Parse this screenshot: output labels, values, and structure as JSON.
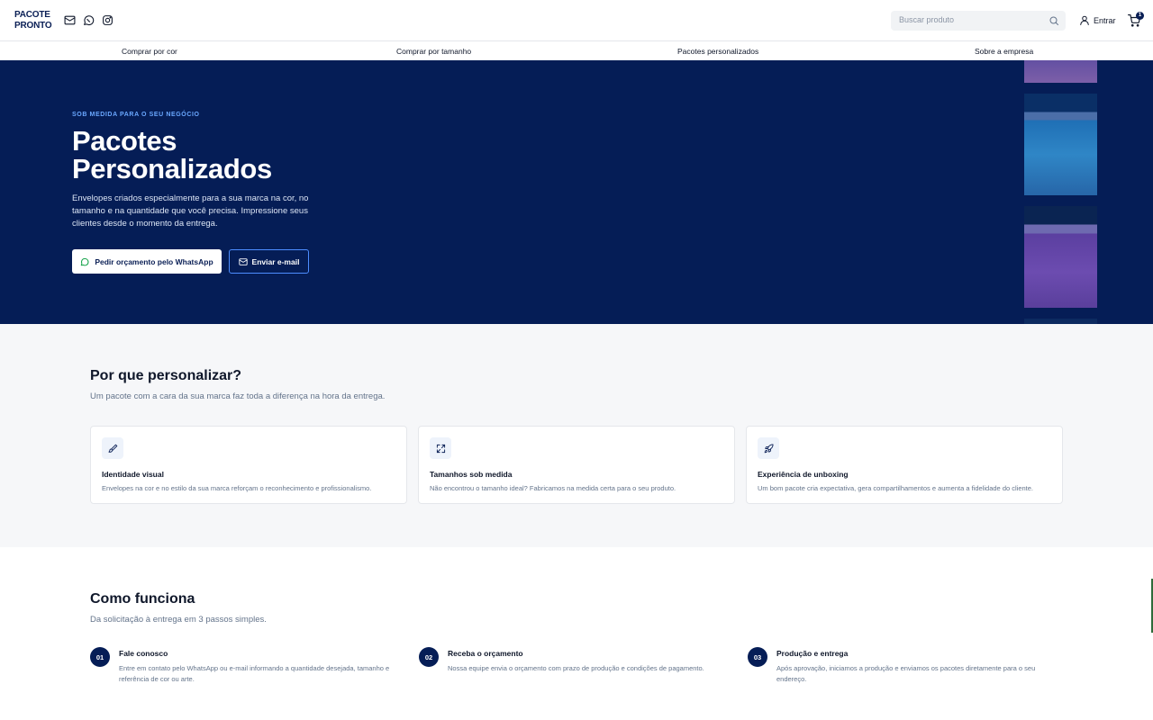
{
  "brand": {
    "line1": "PACOTE",
    "line2": "PRONTO"
  },
  "social": [
    {
      "icon": "mail-icon"
    },
    {
      "icon": "whatsapp-icon"
    },
    {
      "icon": "instagram-icon"
    }
  ],
  "search": {
    "placeholder": "Buscar produto",
    "icon": "search-icon"
  },
  "account": {
    "login_label": "Entrar",
    "icon": "user-icon"
  },
  "cart": {
    "count": "1",
    "icon": "cart-icon"
  },
  "nav": {
    "items": [
      {
        "label": "Comprar por cor"
      },
      {
        "label": "Comprar por tamanho"
      },
      {
        "label": "Pacotes personalizados"
      },
      {
        "label": "Sobre a empresa"
      }
    ]
  },
  "hero": {
    "eyebrow": "SOB MEDIDA PARA O SEU NEGÓCIO",
    "title": "Pacotes Personalizados",
    "description": "Envelopes criados especialmente para a sua marca na cor, no tamanho e na quantidade que você precisa. Impressione seus clientes desde o momento da entrega.",
    "whatsapp_button": "Pedir orçamento pelo WhatsApp",
    "email_button": "Enviar e-mail"
  },
  "why": {
    "title": "Por que personalizar?",
    "subtitle": "Um pacote com a cara da sua marca faz toda a diferença na hora da entrega.",
    "cards": [
      {
        "icon": "brush-icon",
        "title": "Identidade visual",
        "description": "Envelopes na cor e no estilo da sua marca reforçam o reconhecimento e profissionalismo."
      },
      {
        "icon": "expand-icon",
        "title": "Tamanhos sob medida",
        "description": "Não encontrou o tamanho ideal? Fabricamos na medida certa para o seu produto."
      },
      {
        "icon": "rocket-icon",
        "title": "Experiência de unboxing",
        "description": "Um bom pacote cria expectativa, gera compartilhamentos e aumenta a fidelidade do cliente."
      }
    ]
  },
  "how": {
    "title": "Como funciona",
    "subtitle": "Da solicitação à entrega em 3 passos simples.",
    "steps": [
      {
        "number": "01",
        "title": "Fale conosco",
        "description": "Entre em contato pelo WhatsApp ou e-mail informando a quantidade desejada, tamanho e referência de cor ou arte."
      },
      {
        "number": "02",
        "title": "Receba o orçamento",
        "description": "Nossa equipe envia o orçamento com prazo de produção e condições de pagamento."
      },
      {
        "number": "03",
        "title": "Produção e entrega",
        "description": "Após aprovação, iniciamos a produção e enviamos os pacotes diretamente para o seu endereço."
      }
    ]
  }
}
